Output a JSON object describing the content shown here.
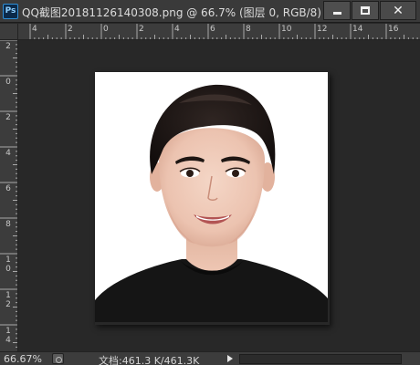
{
  "window": {
    "app_icon_label": "Ps",
    "title": "QQ截图20181126140308.png @ 66.7% (图层 0, RGB/8)",
    "buttons": {
      "minimize": "minimize-icon",
      "maximize": "maximize-icon",
      "close": "close-icon"
    }
  },
  "ruler_h": {
    "labels": [
      "4",
      "2",
      "0",
      "2",
      "4",
      "6",
      "8",
      "10",
      "12",
      "14",
      "16"
    ]
  },
  "ruler_v": {
    "labels": [
      "2",
      "0",
      "2",
      "4",
      "6",
      "8",
      "1 0",
      "1 2",
      "1 4"
    ]
  },
  "canvas": {
    "background": "#282828",
    "document_background": "#ffffff",
    "image_subject": "portrait-photo"
  },
  "status": {
    "zoom": "66.67%",
    "doc_info": "文档:461.3 K/461.3K",
    "icons": [
      "status-options-icon",
      "play-arrow-icon"
    ]
  }
}
